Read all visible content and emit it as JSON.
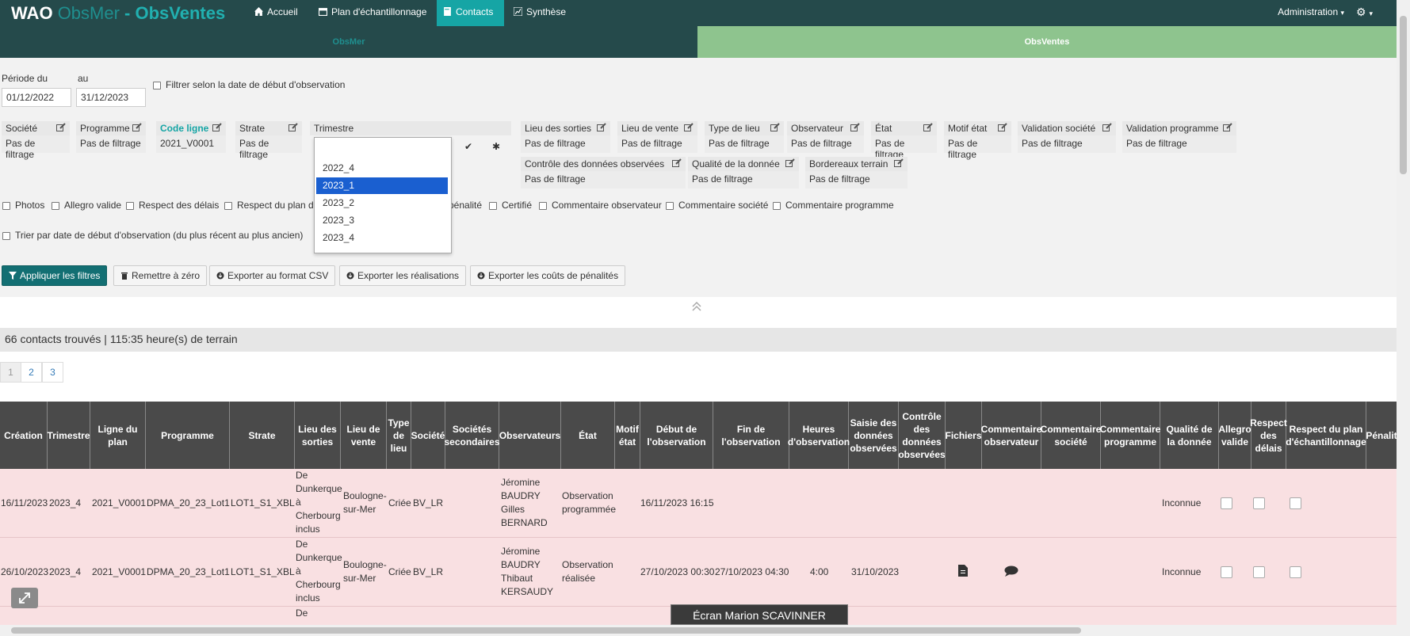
{
  "navbar": {
    "brand_wao": "WAO",
    "brand_obsmer": "ObsMer",
    "brand_sep": " - ",
    "brand_obsventes": "ObsVentes",
    "items": [
      {
        "label": "Accueil",
        "icon": "home-icon"
      },
      {
        "label": "Plan d'échantillonnage",
        "icon": "calendar-icon"
      },
      {
        "label": "Contacts",
        "icon": "book-icon"
      },
      {
        "label": "Synthèse",
        "icon": "chart-icon"
      }
    ],
    "admin": "Administration",
    "admin_caret": "▾",
    "settings_caret": "▾"
  },
  "subtabs": {
    "obsmer": "ObsMer",
    "obsventes": "ObsVentes"
  },
  "period": {
    "label_from": "Période du",
    "label_to": "au",
    "from": "01/12/2022",
    "to": "31/12/2023",
    "filter_start_label": "Filtrer selon la date de début d'observation"
  },
  "filters_row1": [
    {
      "label": "Société",
      "value": "Pas de filtrage"
    },
    {
      "label": "Programme",
      "value": "Pas de filtrage"
    },
    {
      "label": "Code ligne",
      "value": "2021_V0001"
    },
    {
      "label": "Strate",
      "value": "Pas de filtrage"
    },
    {
      "label": "Trimestre",
      "value": ""
    },
    {
      "label": "Lieu des sorties",
      "value": "Pas de filtrage"
    },
    {
      "label": "Lieu de vente",
      "value": "Pas de filtrage"
    },
    {
      "label": "Type de lieu",
      "value": "Pas de filtrage"
    },
    {
      "label": "Observateur",
      "value": "Pas de filtrage"
    },
    {
      "label": "État",
      "value": "Pas de filtrage"
    },
    {
      "label": "Motif état",
      "value": "Pas de filtrage"
    },
    {
      "label": "Validation société",
      "value": "Pas de filtrage"
    },
    {
      "label": "Validation programme",
      "value": "Pas de filtrage"
    }
  ],
  "filters_row2": [
    {
      "label": "Contrôle des données observées",
      "value": "Pas de filtrage"
    },
    {
      "label": "Qualité de la donnée",
      "value": "Pas de filtrage"
    },
    {
      "label": "Bordereaux terrain",
      "value": "Pas de filtrage"
    }
  ],
  "trimestre_options": [
    "2022_4",
    "2023_1",
    "2023_2",
    "2023_3",
    "2023_4"
  ],
  "trimestre_selected": "2023_1",
  "confirm_icons": {
    "check": "✔",
    "reset": "✱"
  },
  "checkboxes": [
    "Photos",
    "Allegro valide",
    "Respect des délais",
    "Respect du plan d",
    "pénalité",
    "Certifié",
    "Commentaire observateur",
    "Commentaire société",
    "Commentaire programme"
  ],
  "sort_label": "Trier par date de début d'observation (du plus récent au plus ancien)",
  "buttons": {
    "apply": "Appliquer les filtres",
    "reset": "Remettre à zéro",
    "export_csv": "Exporter au format CSV",
    "export_real": "Exporter les réalisations",
    "export_costs": "Exporter les coûts de pénalités"
  },
  "summary": "66 contacts trouvés | 115:35 heure(s) de terrain",
  "pagination": [
    "1",
    "2",
    "3"
  ],
  "columns": [
    "Création",
    "Trimestre",
    "Ligne du plan",
    "Programme",
    "Strate",
    "Lieu des sorties",
    "Lieu de vente",
    "Type de lieu",
    "Société",
    "Sociétés secondaires",
    "Observateurs",
    "État",
    "Motif état",
    "Début de l'observation",
    "Fin de l'observation",
    "Heures d'observation",
    "Saisie des données observées",
    "Contrôle des données observées",
    "Fichiers",
    "Commentaire observateur",
    "Commentaire société",
    "Commentaire programme",
    "Qualité de la donnée",
    "Allegro valide",
    "Respect des délais",
    "Respect du plan d'échantillonnage",
    "Pénalit"
  ],
  "rows": [
    {
      "creation": "16/11/2023",
      "trimestre": "2023_4",
      "ligne": "2021_V0001",
      "programme": "DPMA_20_23_Lot1",
      "strate": "LOT1_S1_XBL",
      "lieu_sorties": "De Dunkerque à Cherbourg inclus",
      "lieu_vente": "Boulogne-sur-Mer",
      "type_lieu": "Criée",
      "societe": "BV_LR",
      "observateurs": "Jéromine BAUDRY Gilles BERNARD",
      "etat": "Observation programmée",
      "debut": "16/11/2023 16:15",
      "fin": "",
      "heures": "",
      "saisie": "",
      "qualite": "Inconnue"
    },
    {
      "creation": "26/10/2023",
      "trimestre": "2023_4",
      "ligne": "2021_V0001",
      "programme": "DPMA_20_23_Lot1",
      "strate": "LOT1_S1_XBL",
      "lieu_sorties": "De Dunkerque à Cherbourg inclus",
      "lieu_vente": "Boulogne-sur-Mer",
      "type_lieu": "Criée",
      "societe": "BV_LR",
      "observateurs": "Jéromine BAUDRY Thibaut KERSAUDY",
      "etat": "Observation réalisée",
      "debut": "27/10/2023 00:30",
      "fin": "27/10/2023 04:30",
      "heures": "4:00",
      "saisie": "31/10/2023",
      "qualite": "Inconnue"
    },
    {
      "lieu_sorties": "De"
    }
  ],
  "screen_share_label": "Écran Marion SCAVINNER",
  "colors": {
    "navbar": "#254a4b",
    "accent": "#16a5a5",
    "obsventes": "#8ec48e",
    "row_bg": "#f9e0e2"
  }
}
